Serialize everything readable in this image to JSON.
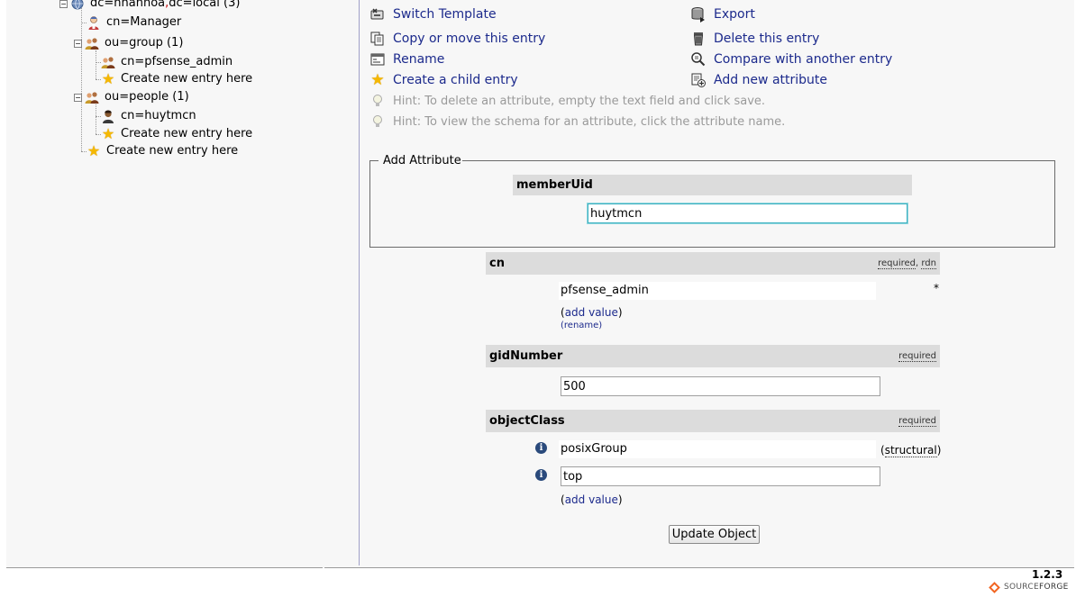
{
  "tree": {
    "root_label_a": "dc=nhanhoa",
    "root_sep": ",",
    "root_label_b": "dc=local (3)",
    "items": [
      {
        "label": "cn=Manager"
      },
      {
        "label": "ou=group (1)"
      },
      {
        "label": "cn=pfsense_admin"
      },
      {
        "label": "Create new entry here"
      },
      {
        "label": "ou=people (1)"
      },
      {
        "label": "cn=huytmcn"
      },
      {
        "label": "Create new entry here"
      },
      {
        "label": "Create new entry here"
      }
    ]
  },
  "actions": {
    "switch_template": "Switch Template",
    "export": "Export",
    "copy_move": "Copy or move this entry",
    "delete": "Delete this entry",
    "rename": "Rename",
    "compare": "Compare with another entry",
    "create_child": "Create a child entry",
    "add_attribute": "Add new attribute"
  },
  "hints": {
    "delete": "Hint: To delete an attribute, empty the text field and click save.",
    "schema": "Hint: To view the schema for an attribute, click the attribute name."
  },
  "add_attribute": {
    "legend": "Add Attribute",
    "name": "memberUid",
    "value": "huytmcn"
  },
  "attributes": {
    "cn": {
      "name": "cn",
      "tag_required": "required",
      "tag_sep": ",",
      "tag_rdn": "rdn",
      "value": "pfsense_admin",
      "asterisk": "*",
      "paren_open": "(",
      "add_value": "add value",
      "paren_close": ")",
      "rename": "(rename)"
    },
    "gidNumber": {
      "name": "gidNumber",
      "tag_required": "required",
      "value": "500"
    },
    "objectClass": {
      "name": "objectClass",
      "tag_required": "required",
      "value1": "posixGroup",
      "structural_open": "(",
      "structural": "structural",
      "structural_close": ")",
      "value2": "top",
      "paren_open": "(",
      "add_value": "add value",
      "paren_close": ")"
    }
  },
  "update_button": "Update Object",
  "footer": {
    "version": "1.2.3",
    "logo_source": "SOURCE",
    "logo_forge": "FORGE"
  },
  "colors": {
    "link": "#1c2a8c",
    "attr_header_bg": "#dcdcdc",
    "focus_border": "#3cb0c0",
    "sourceforge_orange": "#f26522"
  }
}
